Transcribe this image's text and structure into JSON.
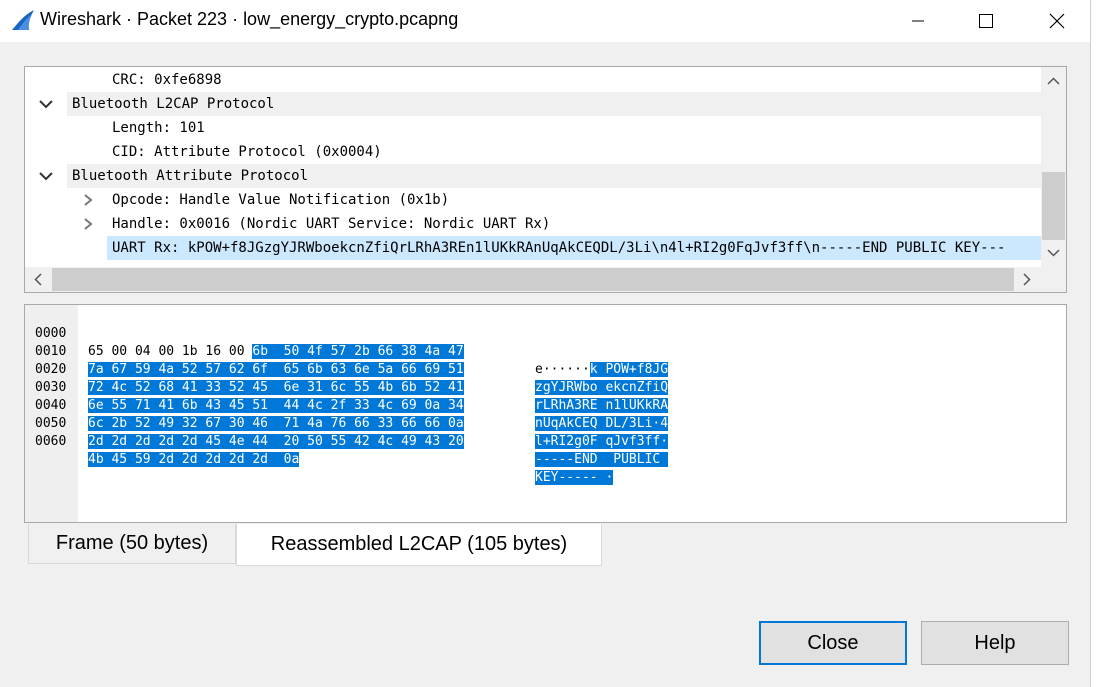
{
  "window": {
    "title": "Wireshark · Packet 223 · low_energy_crypto.pcapng",
    "icon": "wireshark-fin-icon",
    "controls": [
      "minimize-icon",
      "maximize-icon",
      "close-icon"
    ]
  },
  "tree": {
    "rows": [
      {
        "text": "CRC: 0xfe6898",
        "expander": "none",
        "kind": "field"
      },
      {
        "text": "Bluetooth L2CAP Protocol",
        "expander": "expanded",
        "kind": "header"
      },
      {
        "text": "Length: 101",
        "expander": "none",
        "kind": "field"
      },
      {
        "text": "CID: Attribute Protocol (0x0004)",
        "expander": "none",
        "kind": "field"
      },
      {
        "text": "Bluetooth Attribute Protocol",
        "expander": "expanded",
        "kind": "header"
      },
      {
        "text": "Opcode: Handle Value Notification (0x1b)",
        "expander": "collapsed",
        "kind": "field"
      },
      {
        "text": "Handle: 0x0016 (Nordic UART Service: Nordic UART Rx)",
        "expander": "collapsed",
        "kind": "field"
      },
      {
        "text": "UART Rx: kPOW+f8JGzgYJRWboekcnZfiQrLRhA3REn1lUKkRAnUqAkCEQDL/3Li\\n4l+RI2g0FqJvf3ff\\n-----END PUBLIC KEY---",
        "expander": "none",
        "kind": "selected"
      }
    ]
  },
  "hex": {
    "rows": [
      {
        "offset": "0000",
        "hex_plain": "65 00 04 00 1b 16 00 ",
        "hex_sel": "6b  50 4f 57 2b 66 38 4a 47",
        "ascii_plain": "e······",
        "ascii_sel": "k POW+f8JG"
      },
      {
        "offset": "0010",
        "hex_plain": "",
        "hex_sel": "7a 67 59 4a 52 57 62 6f  65 6b 63 6e 5a 66 69 51",
        "ascii_plain": "",
        "ascii_sel": "zgYJRWbo ekcnZfiQ"
      },
      {
        "offset": "0020",
        "hex_plain": "",
        "hex_sel": "72 4c 52 68 41 33 52 45  6e 31 6c 55 4b 6b 52 41",
        "ascii_plain": "",
        "ascii_sel": "rLRhA3RE n1lUKkRA"
      },
      {
        "offset": "0030",
        "hex_plain": "",
        "hex_sel": "6e 55 71 41 6b 43 45 51  44 4c 2f 33 4c 69 0a 34",
        "ascii_plain": "",
        "ascii_sel": "nUqAkCEQ DL/3Li·4"
      },
      {
        "offset": "0040",
        "hex_plain": "",
        "hex_sel": "6c 2b 52 49 32 67 30 46  71 4a 76 66 33 66 66 0a",
        "ascii_plain": "",
        "ascii_sel": "l+RI2g0F qJvf3ff·"
      },
      {
        "offset": "0050",
        "hex_plain": "",
        "hex_sel": "2d 2d 2d 2d 2d 45 4e 44  20 50 55 42 4c 49 43 20",
        "ascii_plain": "",
        "ascii_sel": "-----END  PUBLIC "
      },
      {
        "offset": "0060",
        "hex_plain": "",
        "hex_sel": "4b 45 59 2d 2d 2d 2d 2d  0a",
        "ascii_plain": "",
        "ascii_sel": "KEY----- ·"
      }
    ]
  },
  "tabs": [
    {
      "label": "Frame (50 bytes)",
      "active": false
    },
    {
      "label": "Reassembled L2CAP (105 bytes)",
      "active": true
    }
  ],
  "buttons": {
    "close": "Close",
    "help": "Help"
  },
  "colors": {
    "selection": "#0078d7",
    "tree_selection": "#cce8ff",
    "default_button_border": "#0078d7"
  }
}
